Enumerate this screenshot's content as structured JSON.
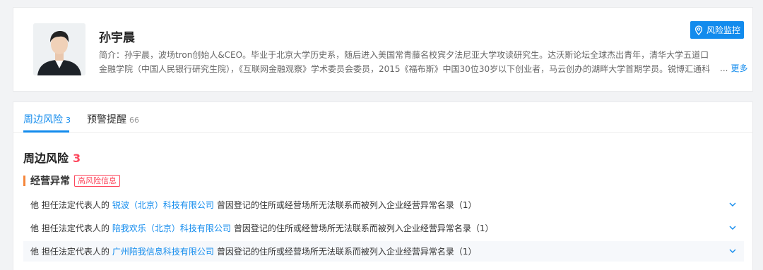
{
  "profile": {
    "name": "孙宇晨",
    "bio": "简介：孙宇晨，波场tron创始人&CEO。毕业于北京大学历史系，随后进入美国常青藤名校宾夕法尼亚大学攻读研究生。达沃斯论坛全球杰出青年，清华大学五道口金融学院（中国人民银行研究生院），《互联网金融观察》学术委员会委员，2015《福布斯》中国30位30岁以下创业者，马云创办的湖畔大学首期学员。锐博汇通科技创始人、",
    "ellipsis": "...",
    "more_label": "更多",
    "monitor_label": "风险监控"
  },
  "tabs": [
    {
      "label": "周边风险",
      "count": "3"
    },
    {
      "label": "预警提醒",
      "count": "66"
    }
  ],
  "section": {
    "title": "周边风险",
    "count": "3",
    "sub_title": "经营异常",
    "badge": "高风险信息"
  },
  "risks": [
    {
      "prefix": "他 担任法定代表人的",
      "company": "锐波（北京）科技有限公司",
      "suffix": "曾因登记的住所或经营场所无法联系而被列入企业经营异常名录（1）"
    },
    {
      "prefix": "他 担任法定代表人的",
      "company": "陪我欢乐（北京）科技有限公司",
      "suffix": "曾因登记的住所或经营场所无法联系而被列入企业经营异常名录（1）"
    },
    {
      "prefix": "他 担任法定代表人的",
      "company": "广州陪我信息科技有限公司",
      "suffix": "曾因登记的住所或经营场所无法联系而被列入企业经营异常名录（1）"
    }
  ],
  "colors": {
    "accent": "#128bed",
    "danger": "#fd485e",
    "marker": "#f5863b"
  },
  "icons": {
    "monitor": "location-pin-icon",
    "expand": "chevron-down-icon"
  }
}
